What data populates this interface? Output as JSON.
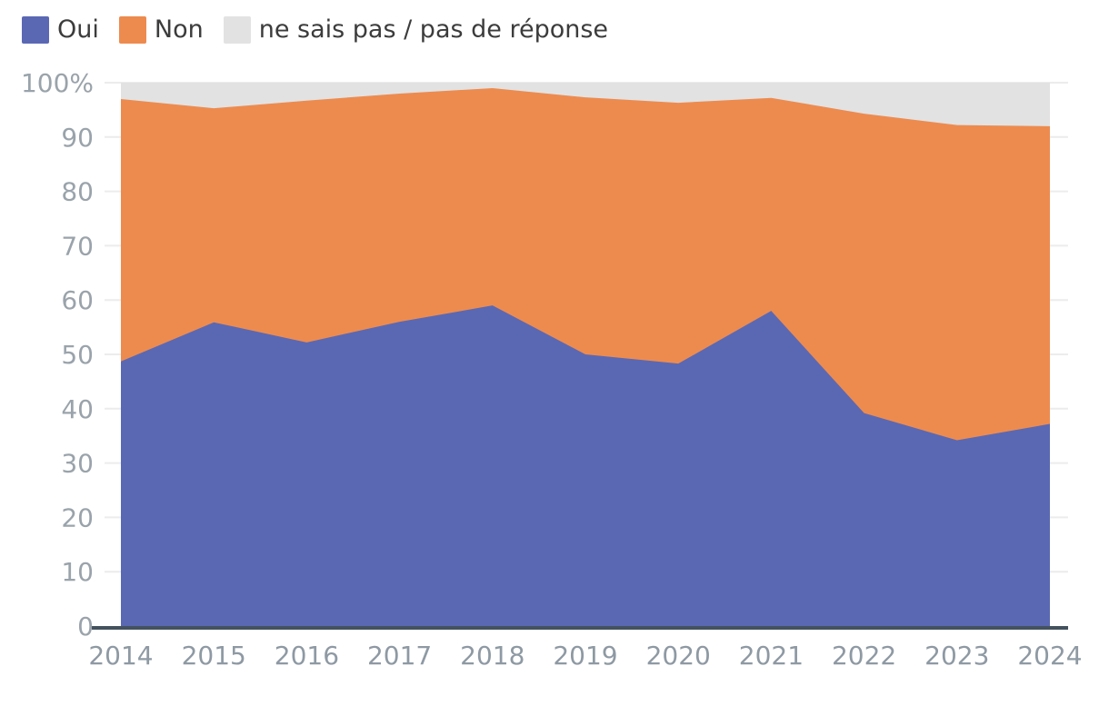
{
  "legend": {
    "items": [
      {
        "label": "Oui",
        "color": "#5a68b4",
        "swatch_name": "legend-swatch-oui"
      },
      {
        "label": "Non",
        "color": "#ed8b4f",
        "swatch_name": "legend-swatch-non"
      },
      {
        "label": "ne sais pas / pas de réponse",
        "color": "#e2e2e2",
        "swatch_name": "legend-swatch-nsp"
      }
    ]
  },
  "axes": {
    "y_ticks": [
      "100%",
      "90",
      "80",
      "70",
      "60",
      "50",
      "40",
      "30",
      "20",
      "10",
      "0"
    ],
    "x_ticks": [
      "2014",
      "2015",
      "2016",
      "2017",
      "2018",
      "2019",
      "2020",
      "2021",
      "2022",
      "2023",
      "2024"
    ]
  },
  "chart_data": {
    "type": "area",
    "stacked": true,
    "normalized_percent": true,
    "title": "",
    "subtitle": "",
    "xlabel": "",
    "ylabel": "",
    "ylim": [
      0,
      100
    ],
    "grid": true,
    "legend_position": "top-left",
    "categories": [
      "2014",
      "2015",
      "2016",
      "2017",
      "2018",
      "2019",
      "2020",
      "2021",
      "2022",
      "2023",
      "2024"
    ],
    "x": [
      2014,
      2015,
      2016,
      2017,
      2018,
      2019,
      2020,
      2021,
      2022,
      2023,
      2024
    ],
    "series": [
      {
        "name": "Oui",
        "color": "#5a68b4",
        "values": [
          48.7,
          55.9,
          52.2,
          56.0,
          59.0,
          50.0,
          48.3,
          58.0,
          39.2,
          34.2,
          37.2
        ]
      },
      {
        "name": "Non",
        "color": "#ed8b4f",
        "values": [
          48.3,
          39.4,
          44.5,
          42.0,
          40.0,
          47.3,
          48.0,
          39.2,
          55.1,
          58.0,
          54.8
        ]
      },
      {
        "name": "ne sais pas / pas de réponse",
        "color": "#e2e2e2",
        "values": [
          3.0,
          4.7,
          3.3,
          2.0,
          1.0,
          2.7,
          3.7,
          2.8,
          5.7,
          7.8,
          8.0
        ]
      }
    ],
    "cumulative_tops": {
      "oui": [
        48.7,
        55.9,
        52.2,
        56.0,
        59.0,
        50.0,
        48.3,
        58.0,
        39.2,
        34.2,
        37.2
      ],
      "oui_plus_non": [
        97.0,
        95.3,
        96.7,
        98.0,
        99.0,
        97.3,
        96.3,
        97.2,
        94.3,
        92.2,
        92.0
      ],
      "total": [
        100,
        100,
        100,
        100,
        100,
        100,
        100,
        100,
        100,
        100,
        100
      ]
    }
  },
  "colors": {
    "oui": "#5a68b4",
    "non": "#ed8b4f",
    "nsp": "#e2e2e2",
    "gridline": "#ececec",
    "axis": "#44525f",
    "tick_text": "#8e99a3",
    "legend_text": "#3c3c3c",
    "background": "#ffffff"
  }
}
